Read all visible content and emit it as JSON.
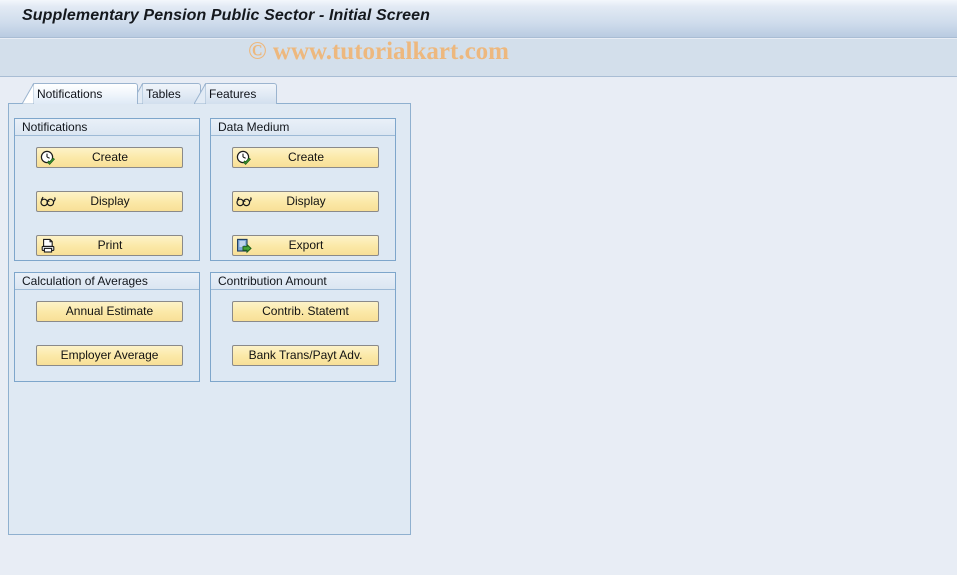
{
  "window": {
    "title": "Supplementary Pension Public Sector - Initial Screen",
    "watermark": "© www.tutorialkart.com"
  },
  "tabs": [
    {
      "label": "Notifications",
      "active": true
    },
    {
      "label": "Tables",
      "active": false
    },
    {
      "label": "Features",
      "active": false
    }
  ],
  "groups": {
    "notifications": {
      "title": "Notifications",
      "buttons": [
        {
          "label": "Create",
          "icon": "clock-check-icon"
        },
        {
          "label": "Display",
          "icon": "eyeglasses-icon"
        },
        {
          "label": "Print",
          "icon": "printer-icon"
        }
      ]
    },
    "data_medium": {
      "title": "Data Medium",
      "buttons": [
        {
          "label": "Create",
          "icon": "clock-check-icon"
        },
        {
          "label": "Display",
          "icon": "eyeglasses-icon"
        },
        {
          "label": "Export",
          "icon": "export-document-icon"
        }
      ]
    },
    "calculation_of_averages": {
      "title": "Calculation of Averages",
      "buttons": [
        {
          "label": "Annual Estimate",
          "icon": ""
        },
        {
          "label": "Employer Average",
          "icon": ""
        }
      ]
    },
    "contribution_amount": {
      "title": "Contribution Amount",
      "buttons": [
        {
          "label": "Contrib. Statemt",
          "icon": ""
        },
        {
          "label": "Bank Trans/Payt Adv.",
          "icon": ""
        }
      ]
    }
  },
  "colors": {
    "title_gradient_top": "#f3f7fc",
    "title_gradient_bottom": "#b9cbe1",
    "toolbar_band": "#d3dfeb",
    "page_background": "#e8edf5",
    "panel_background": "#dfe9f3",
    "panel_border": "#8fb0cf",
    "button_face": "#fbe9a8",
    "button_border": "#8a8a8a",
    "watermark": "#edb87e"
  }
}
